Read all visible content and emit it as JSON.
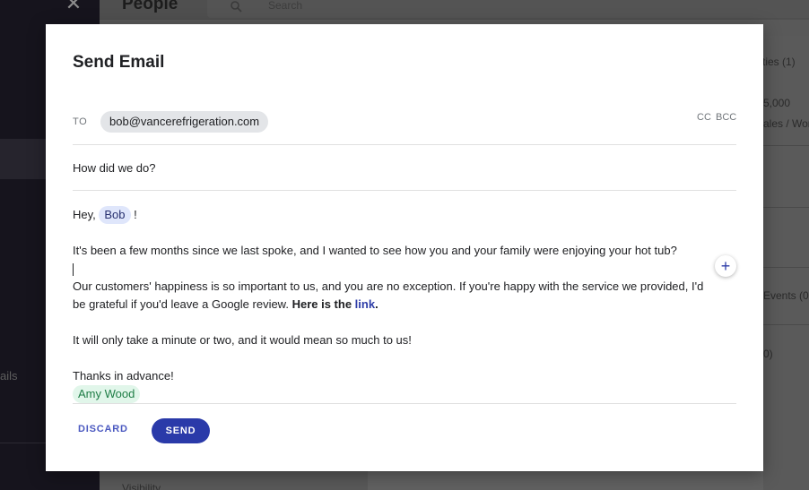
{
  "background": {
    "page_title": "People",
    "search_placeholder": "Search",
    "side_text": "ails",
    "right_texts": [
      "ties (1)",
      "5,000",
      "ales / Wor",
      "Events (0",
      "0)"
    ],
    "bottom_label": "Visibility"
  },
  "modal": {
    "title": "Send Email",
    "to_label": "TO",
    "recipient": "bob@vancerefrigeration.com",
    "cc_label": "CC",
    "bcc_label": "BCC",
    "subject": "How did we do?",
    "body": {
      "greeting_prefix": "Hey, ",
      "greeting_name": "Bob",
      "greeting_suffix": " !",
      "paragraph1": "It's been a few months since we last spoke, and I wanted to see how you and your family were enjoying your hot tub?",
      "paragraph2_text": "Our customers' happiness is so important to us, and you are no exception. If you're happy with the service we provided, I'd be grateful if you'd leave a Google review. ",
      "paragraph2_bold": "Here is the ",
      "paragraph2_link": "link",
      "paragraph2_end": ".",
      "paragraph3": "It will only take a minute or two, and it would mean so much to us!",
      "signoff": "Thanks in advance!",
      "signature": "Amy Wood"
    },
    "insert_button": "+",
    "discard_label": "DISCARD",
    "send_label": "SEND"
  },
  "colors": {
    "primary": "#2a3aa9",
    "chip_blue_bg": "#dfe6fb",
    "chip_green_bg": "#e1f6ea",
    "chip_green_text": "#1e7d46"
  }
}
